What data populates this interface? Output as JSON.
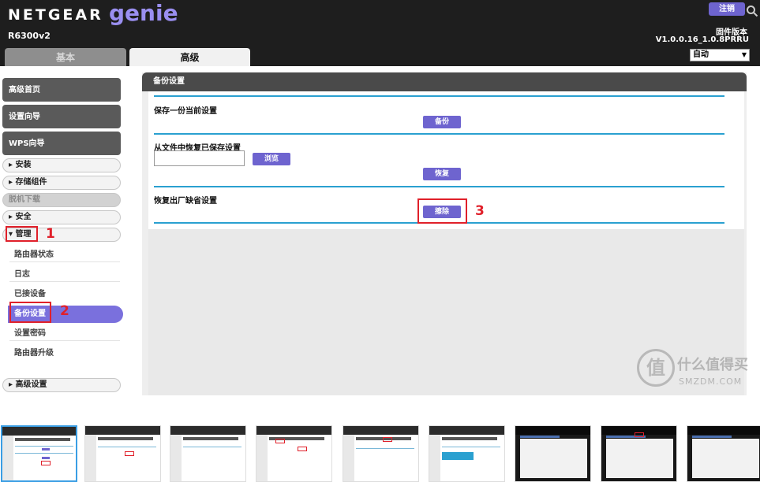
{
  "header": {
    "brand": "NETGEAR",
    "product": "genie",
    "model": "R6300v2",
    "logout_label": "注销",
    "firmware_label": "固件版本",
    "firmware_version": "V1.0.0.16_1.0.8PRRU",
    "language": "自动",
    "tabs": [
      {
        "label": "基本",
        "active": false
      },
      {
        "label": "高级",
        "active": true
      }
    ]
  },
  "sidebar": {
    "big_buttons": [
      "高级首页",
      "设置向导",
      "WPS向导"
    ],
    "items": [
      {
        "label": "▸ 安装"
      },
      {
        "label": "▸ 存储组件"
      },
      {
        "label": "脱机下载",
        "disabled": true
      },
      {
        "label": "▸ 安全"
      },
      {
        "label": "▾ 管理"
      }
    ],
    "sub_items": [
      "路由器状态",
      "日志",
      "已接设备",
      "备份设置",
      "设置密码",
      "路由器升级"
    ],
    "active_sub_item": "备份设置",
    "bottom_item": "▸ 高级设置"
  },
  "main": {
    "panel_title": "备份设置",
    "sections": [
      {
        "label": "保存一份当前设置",
        "button": "备份"
      },
      {
        "label": "从文件中恢复已保存设置",
        "browse_button": "浏览",
        "button": "恢复"
      },
      {
        "label": "恢复出厂缺省设置",
        "button": "擦除"
      }
    ]
  },
  "annotations": {
    "step1": "1",
    "step2": "2",
    "step3": "3",
    "color": "#e0202a"
  },
  "watermark": {
    "glyph": "值",
    "line1": "什么值得买",
    "line2": "SMZDM.COM"
  },
  "colors": {
    "accent": "#6e64cf",
    "divider": "#2aa0d0",
    "header": "#1e1e1e"
  }
}
